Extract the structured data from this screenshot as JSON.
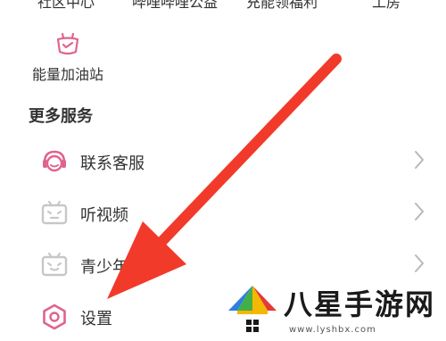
{
  "top_row": {
    "labels": [
      "社区中心",
      "哔哩哔哩公益",
      "充能领福利",
      "工房"
    ]
  },
  "energy_station": {
    "label": "能量加油站",
    "icon": "gas-station-icon",
    "color": "#e0638f"
  },
  "more_services": {
    "title": "更多服务",
    "items": [
      {
        "label": "联系客服",
        "icon": "customer-service-icon"
      },
      {
        "label": "听视频",
        "icon": "tv-headphone-icon"
      },
      {
        "label": "青少年守",
        "icon": "tv-child-icon"
      },
      {
        "label": "设置",
        "icon": "settings-icon"
      }
    ]
  },
  "annotation": {
    "type": "arrow",
    "color": "#f23a2a"
  },
  "watermark": {
    "title": "八星手游网",
    "url": "www.lyshbx.com"
  },
  "colors": {
    "accent_pink": "#e0638f",
    "icon_gray": "#c7c7c7",
    "chevron_gray": "#b8b8b8",
    "arrow_red": "#f23a2a"
  }
}
